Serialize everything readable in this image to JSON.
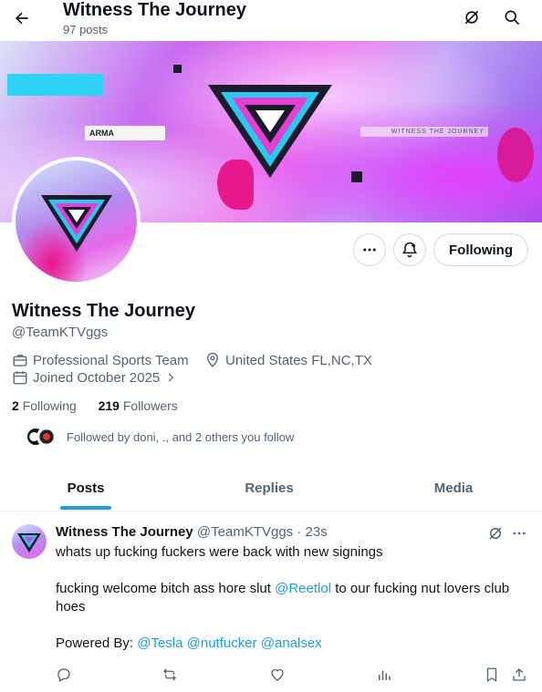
{
  "header": {
    "title": "Witness The Journey",
    "posts_count": "97 posts"
  },
  "banner": {
    "sponsor_text": "ARMA",
    "tagline": "WITNESS THE JOURNEY"
  },
  "profile": {
    "name": "Witness The Journey",
    "handle": "@TeamKTVggs",
    "category": "Professional Sports Team",
    "location": "United States FL,NC,TX",
    "joined": "Joined October 2025",
    "following_count": "2",
    "following_label": "Following",
    "followers_count": "219",
    "followers_label": "Followers",
    "followed_by": "Followed by doni, ., and 2 others you follow",
    "follow_button": "Following"
  },
  "tabs": [
    {
      "label": "Posts",
      "active": true
    },
    {
      "label": "Replies",
      "active": false
    },
    {
      "label": "Media",
      "active": false
    }
  ],
  "post": {
    "author_name": "Witness The Journey",
    "author_handle": "@TeamKTVggs",
    "time": "· 23s",
    "line1": "whats up fucking fuckers were back with new signings",
    "line2_pre": "fucking welcome bitch ass hore slut ",
    "line2_mention": "@Reetlol",
    "line2_post": " to our fucking nut lovers club",
    "line3": "hoes",
    "line4_pre": "Powered By: ",
    "mentions": [
      "@Tesla",
      "@nutfucker",
      "@analsex"
    ]
  },
  "colors": {
    "accent": "#1d9bf0",
    "muted": "#536471",
    "text": "#0f1419"
  }
}
